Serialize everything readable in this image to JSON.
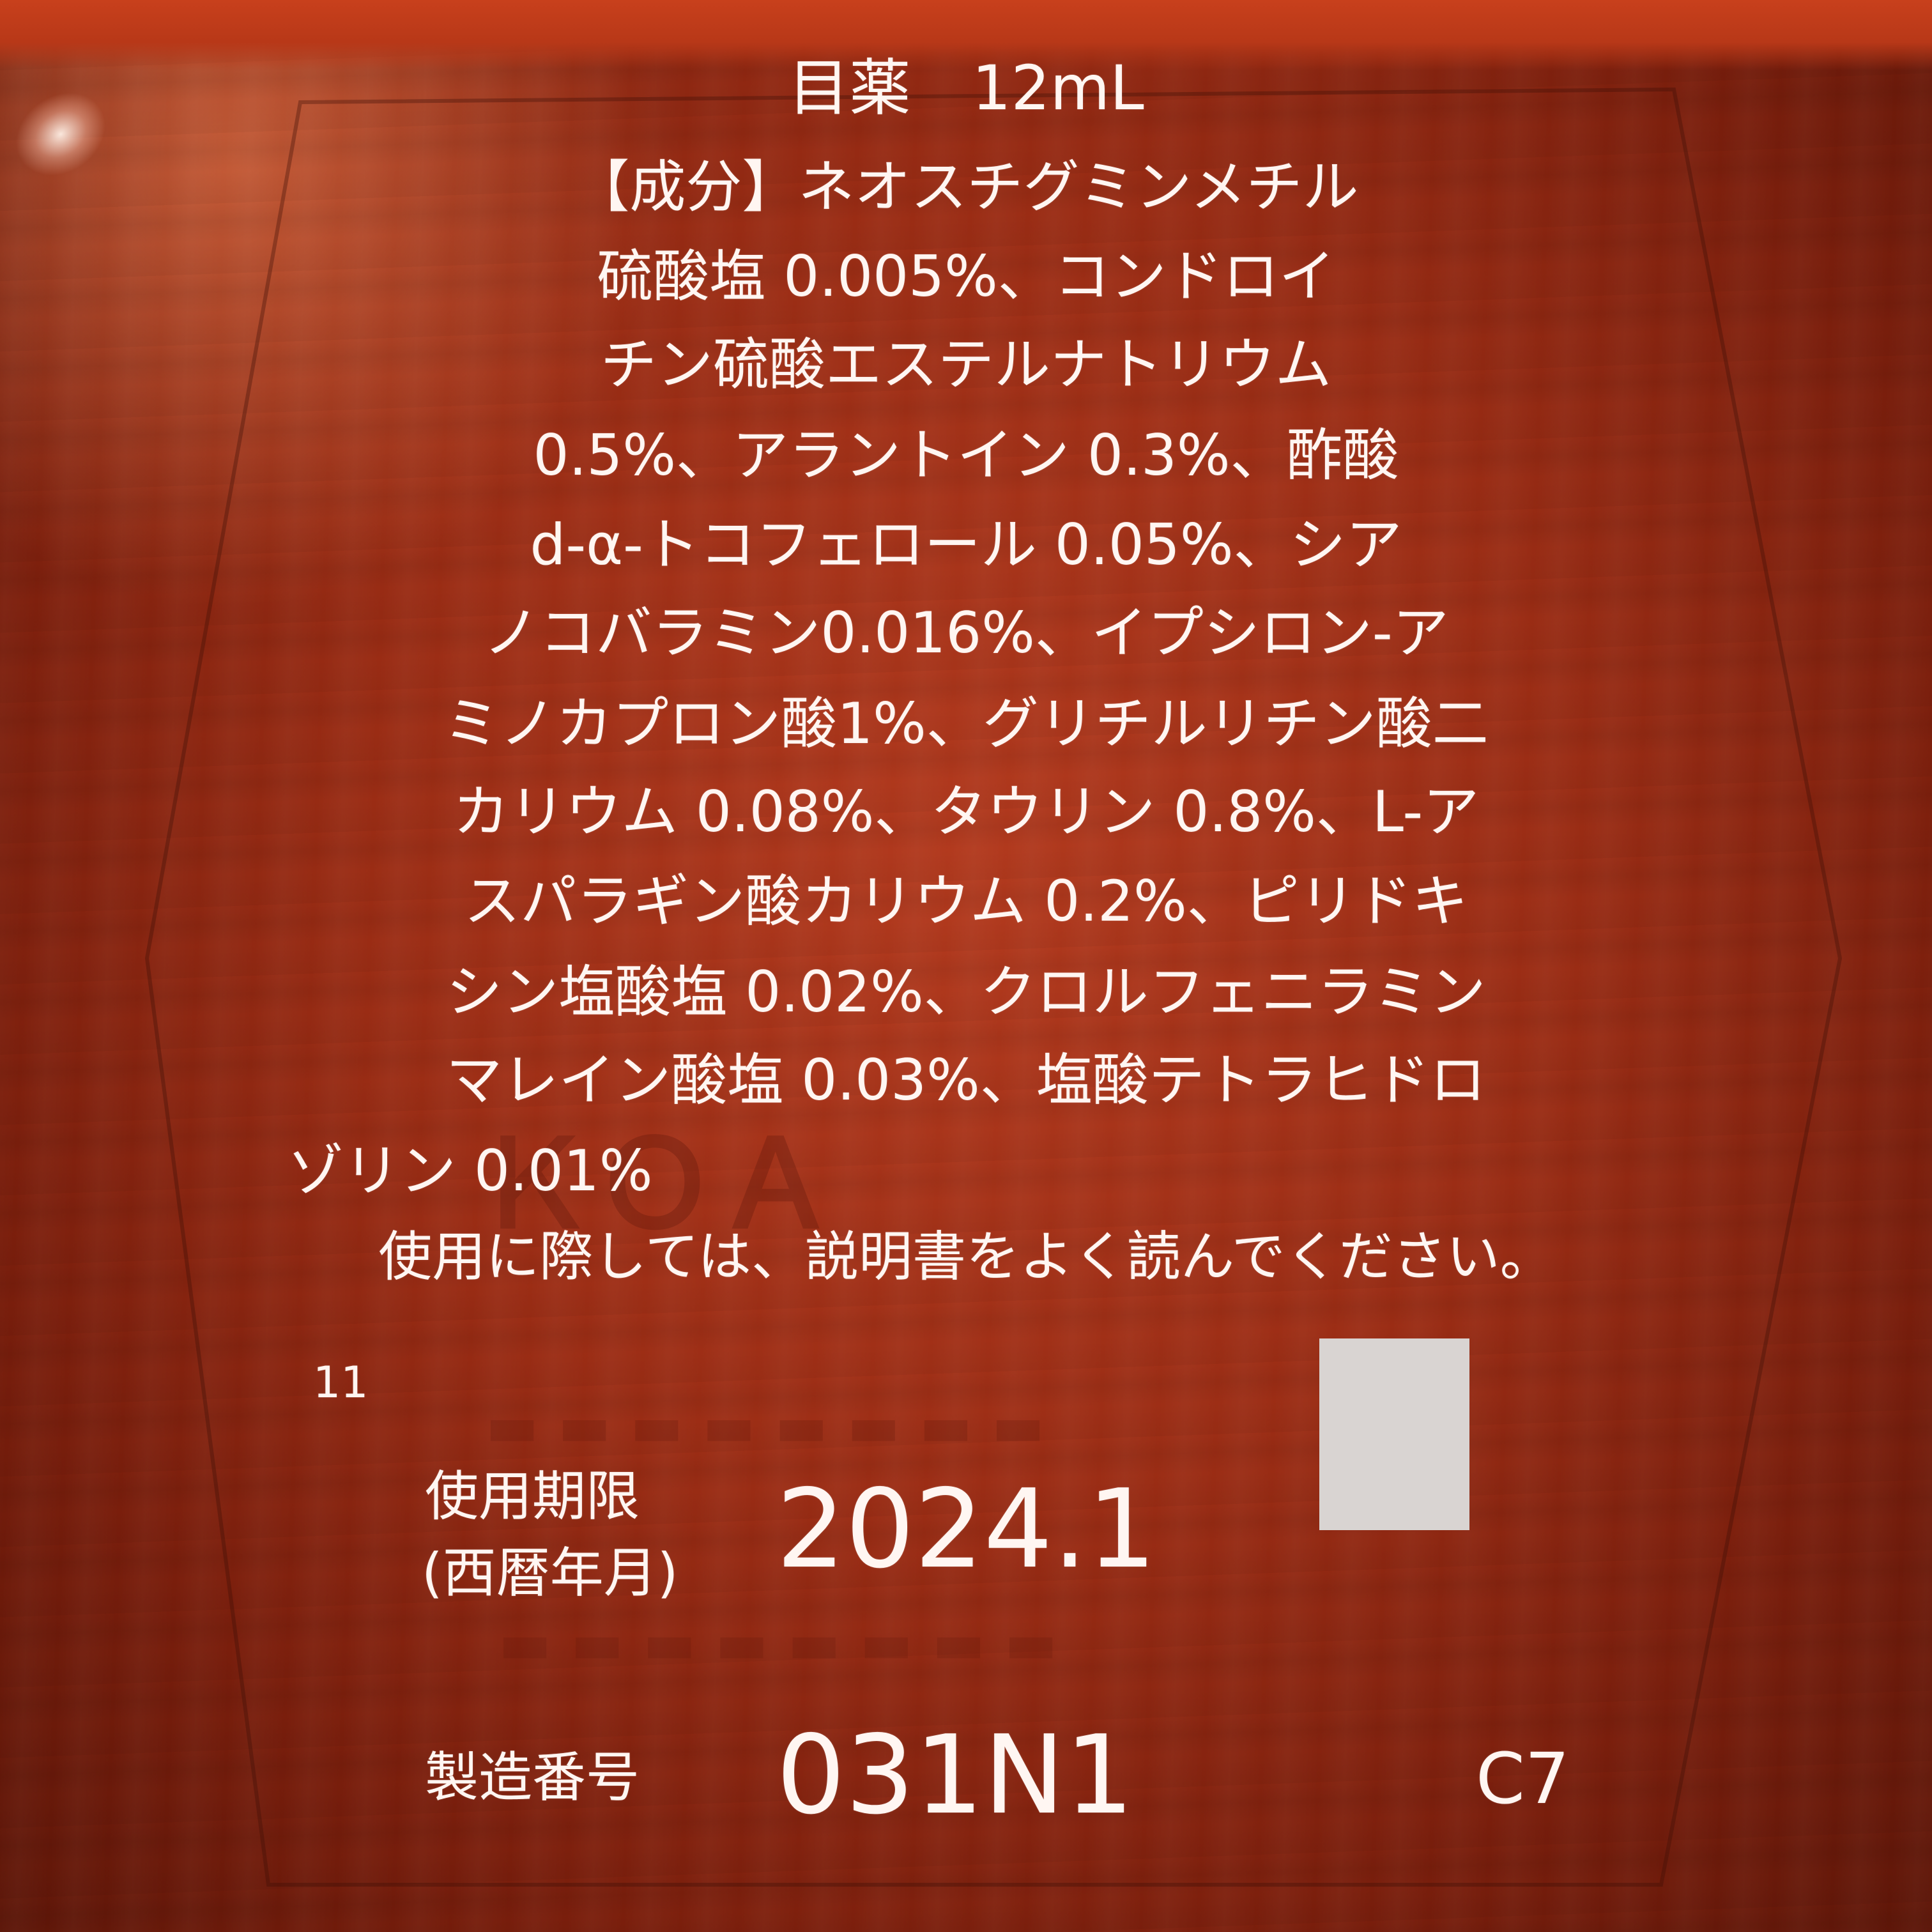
{
  "label": {
    "title": "目薬　12mL",
    "ingredients_lines": [
      "【成分】ネオスチグミンメチル",
      "硫酸塩 0.005%、コンドロイ",
      "チン硫酸エステルナトリウム",
      "0.5%、アラントイン 0.3%、酢酸",
      "d-α-トコフェロール 0.05%、シア",
      "ノコバラミン0.016%、イプシロン-ア",
      "ミノカプロン酸1%、グリチルリチン酸二",
      "カリウム 0.08%、タウリン 0.8%、L-ア",
      "スパラギン酸カリウム 0.2%、ピリドキ",
      "シン塩酸塩 0.02%、クロルフェニラミン",
      "マレイン酸塩 0.03%、塩酸テトラヒドロ",
      "ゾリン 0.01%"
    ],
    "notice": "使用に際しては、説明書をよく読んでください。",
    "number_mark": "11",
    "expiry_label_line1": "使用期限",
    "expiry_label_line2": "(西暦年月)",
    "expiry_value": "2024.1",
    "lot_label": "製造番号",
    "lot_value": "031N1",
    "code": "C7"
  },
  "colors": {
    "background": "#9a2c14",
    "text": "#fff6f2"
  }
}
